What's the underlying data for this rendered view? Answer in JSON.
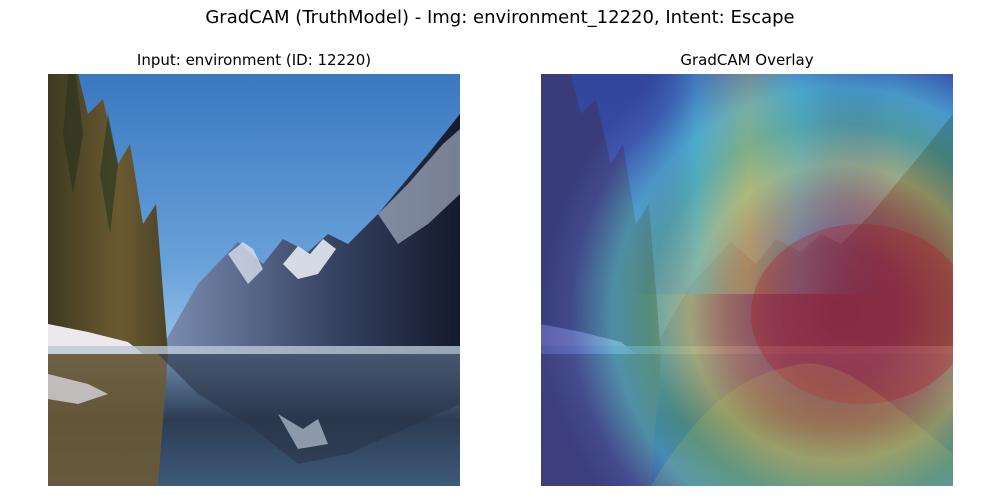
{
  "figure": {
    "title": "GradCAM (TruthModel) - Img: environment_12220, Intent: Escape"
  },
  "panels": [
    {
      "title": "Input: environment (ID: 12220)",
      "image_description_hint": "mountain-lake-photo"
    },
    {
      "title": "GradCAM Overlay",
      "image_description_hint": "gradcam-heatmap-overlay"
    }
  ],
  "colors": {
    "sky_top": "#3f7fc4",
    "sky_bottom": "#7db0e0",
    "heat_red": "#a8202a",
    "heat_yellow": "#d9d65a",
    "heat_cyan": "#4fc2d9",
    "heat_blue": "#3a46a8"
  }
}
